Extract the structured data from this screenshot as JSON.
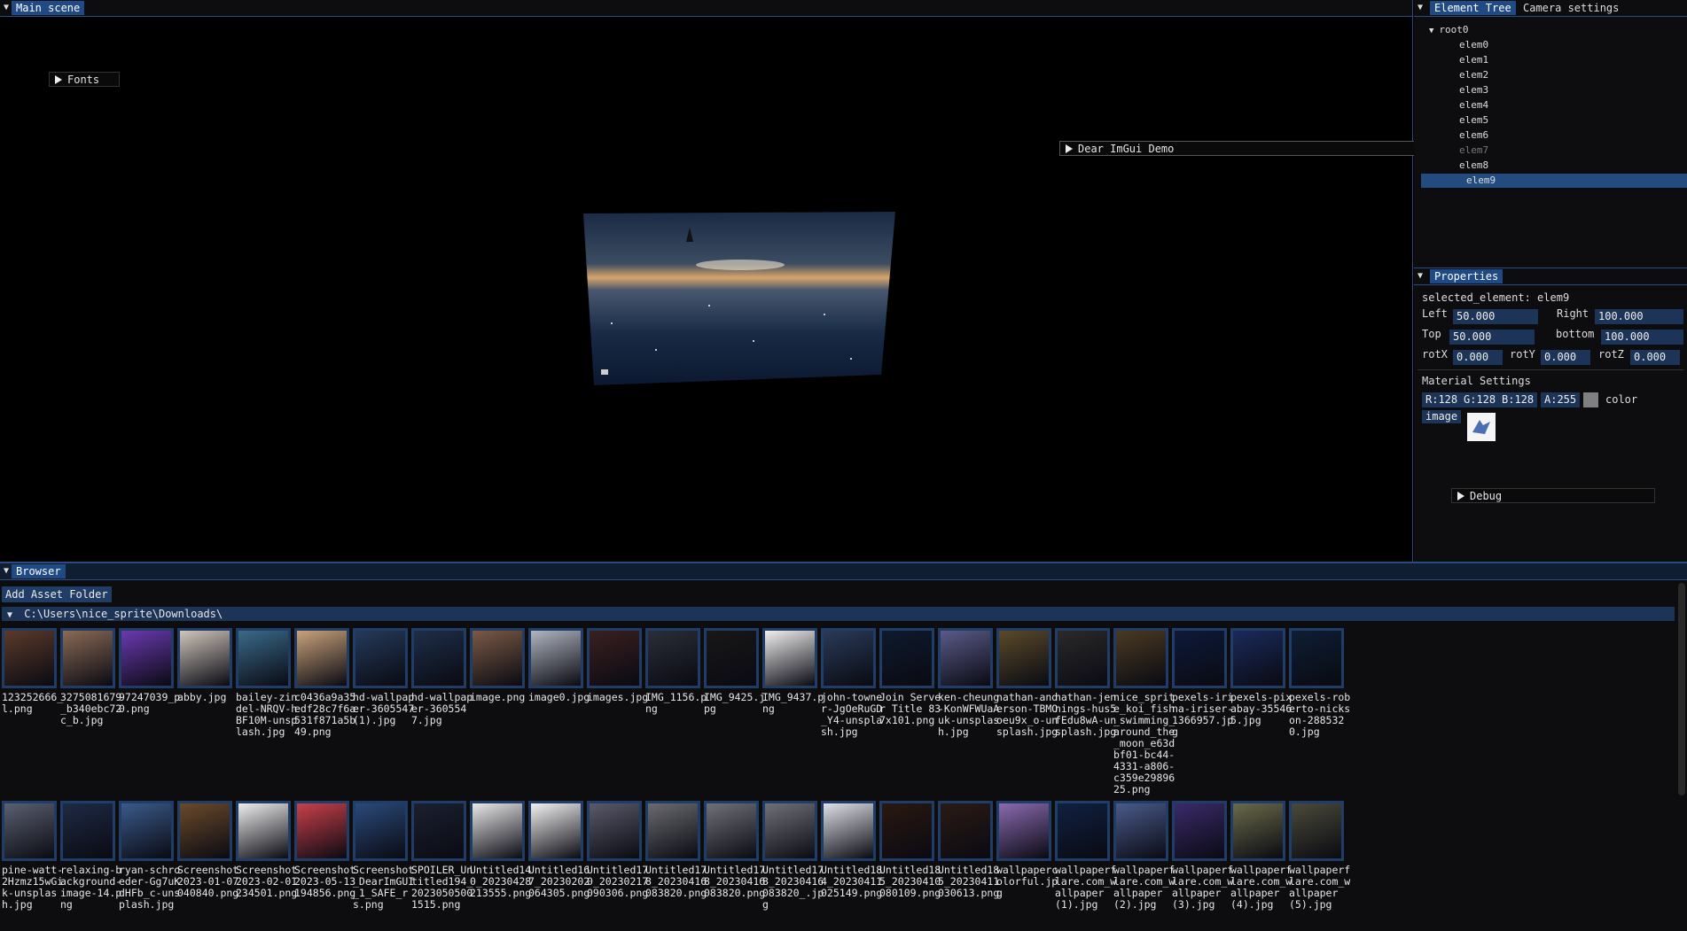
{
  "main_scene": {
    "title": "Main scene",
    "fonts_label": "Fonts",
    "demo_label": "Dear ImGui Demo"
  },
  "element_tree": {
    "tab_active": "Element Tree",
    "tab_inactive": "Camera settings",
    "root": "root0",
    "items": [
      "elem0",
      "elem1",
      "elem2",
      "elem3",
      "elem4",
      "elem5",
      "elem6",
      "elem7",
      "elem8",
      "elem9"
    ],
    "selected": "elem9"
  },
  "properties": {
    "title": "Properties",
    "selected_line": "selected_element: elem9",
    "left_label": "Left",
    "left_value": "50.000",
    "right_label": "Right",
    "right_value": "100.000",
    "top_label": "Top",
    "top_value": "50.000",
    "bottom_label": "bottom",
    "bottom_value": "100.000",
    "rotx_label": "rotX",
    "rotx_value": "0.000",
    "roty_label": "rotY",
    "roty_value": "0.000",
    "rotz_label": "rotZ",
    "rotz_value": "0.000",
    "material_label": "Material Settings",
    "r": "R:128",
    "g": "G:128",
    "b": "B:128",
    "a": "A:255",
    "color_label": "color",
    "image_label": "image",
    "debug_label": "Debug"
  },
  "browser": {
    "title": "Browser",
    "add_button": "Add Asset Folder",
    "path": "C:\\Users\\nice_sprite\\Downloads\\",
    "row1": [
      "123252666_l.png",
      "3275081679_b340ebc72c_b.jpg",
      "97247039_p0.png",
      "abby.jpg",
      "bailey-zindel-NRQV-hBF10M-unsplash.jpg",
      "c0436a9a35edf28c7f6a531f871a5b49.png",
      "hd-wallpaper-3605547 (1).jpg",
      "hd-wallpaper-3605547.jpg",
      "image.png",
      "image0.jpg",
      "images.jpg",
      "IMG_1156.png",
      "IMG_9425.jpg",
      "IMG_9437.png",
      "john-towner-JgOeRuGD_Y4-unsplash.jpg",
      "Join Server Title 837x101.png",
      "ken-cheung-KonWFWUaAuk-unsplash.jpg",
      "nathan-anderson-TBMOoeu9x_o-unsplash.jpg",
      "nathan-jennings-hus5fEdu8wA-unsplash.jpg",
      "nice_sprite_koi_fish_swimming_around_the_moon_e63dbf01-bc44-4331-a806-c359e2989625.png",
      "pexels-irina-iriser-1366957.jpg",
      "pexels-pixabay-355465.jpg",
      "pexels-roberto-nickson-2885320.jpg"
    ],
    "row2": [
      "pine-watt-2Hzmz15wGik-unsplash.jpg",
      "relaxing-background-image-14.png",
      "ryan-schroeder-Gg7uKdHFb_c-unsplash.jpg",
      "Screenshot 2023-01-07 040840.png",
      "Screenshot 2023-02-01 234501.png",
      "Screenshot 2023-05-13 194856.png",
      "Screenshot_DearImGUI_1_SAFE_rs.png",
      "SPOILER_Untitled194_20230505001515.png",
      "Untitled140_20230428213555.png",
      "Untitled167_20230202064305.png",
      "Untitled170_20230217090306.png",
      "Untitled178_20230416083820.png",
      "Untitled178_20230416083820.png",
      "Untitled178_20230416083820_.jpg",
      "Untitled184_20230411025149.png",
      "Untitled185_20230410080109.png",
      "Untitled185_20230411030613.png",
      "wallpapercolorful.jpg",
      "wallpaperflare.com_wallpaper (1).jpg",
      "wallpaperflare.com_wallpaper (2).jpg",
      "wallpaperflare.com_wallpaper (3).jpg",
      "wallpaperflare.com_wallpaper (4).jpg",
      "wallpaperflare.com_wallpaper (5).jpg"
    ]
  }
}
